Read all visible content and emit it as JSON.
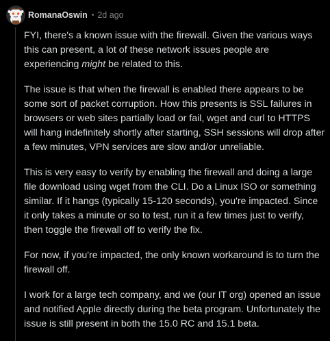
{
  "comment": {
    "username": "RomanaOswin",
    "separator": "•",
    "timestamp": "2d ago",
    "avatar_icon": "snoo-avatar-icon",
    "paragraphs": [
      {
        "before": "FYI, there's a known issue with the firewall. Given the various ways this can present, a lot of these network issues people are experiencing ",
        "emphasis": "might",
        "after": " be related to this."
      },
      {
        "text": "The issue is that when the firewall is enabled there appears to be some sort of packet corruption. How this presents is SSL failures in browsers or web sites partially load or fail, wget and curl to HTTPS will hang indefinitely shortly after starting, SSH sessions will drop after a few minutes, VPN services are slow and/or unreliable."
      },
      {
        "text": "This is very easy to verify by enabling the firewall and doing a large file download using wget from the CLI. Do a Linux ISO or something similar. If it hangs (typically 15-120 seconds), you're impacted. Since it only takes a minute or so to test, run it a few times just to verify, then toggle the firewall off to verify the fix."
      },
      {
        "text": "For now, if you're impacted, the only known workaround is to turn the firewall off."
      },
      {
        "text": "I work for a large tech company, and we (our IT org) opened an issue and notified Apple directly during the beta program. Unfortunately the issue is still present in both the 15.0 RC and 15.1 beta."
      }
    ]
  }
}
